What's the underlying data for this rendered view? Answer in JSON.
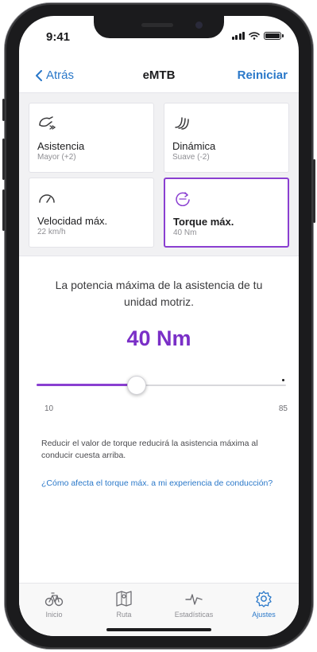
{
  "status": {
    "time": "9:41"
  },
  "nav": {
    "back_label": "Atrás",
    "title": "eMTB",
    "reset_label": "Reiniciar"
  },
  "tiles": [
    {
      "label": "Asistencia",
      "value": "Mayor (+2)",
      "icon": "assist-icon"
    },
    {
      "label": "Dinámica",
      "value": "Suave (-2)",
      "icon": "dynamics-icon"
    },
    {
      "label": "Velocidad máx.",
      "value": "22 km/h",
      "icon": "speedometer-icon"
    },
    {
      "label": "Torque máx.",
      "value": "40 Nm",
      "icon": "torque-icon",
      "selected": true
    }
  ],
  "detail": {
    "description": "La potencia máxima de la asistencia de tu unidad motriz.",
    "value": "40 Nm",
    "slider": {
      "min": 10,
      "max": 85,
      "current": 40,
      "min_label": "10",
      "max_label": "85"
    },
    "note": "Reducir el valor de torque reducirá la asistencia máxima al conducir cuesta arriba.",
    "help_link": "¿Cómo afecta el torque máx. a mi experiencia de conducción?"
  },
  "tabbar": {
    "items": [
      {
        "label": "Inicio",
        "icon": "bike-icon"
      },
      {
        "label": "Ruta",
        "icon": "map-icon"
      },
      {
        "label": "Estadísticas",
        "icon": "activity-icon"
      },
      {
        "label": "Ajustes",
        "icon": "gear-icon",
        "active": true
      }
    ]
  },
  "colors": {
    "accent": "#8a3fd1",
    "link": "#2a78c9",
    "value": "#7a2fc7"
  }
}
